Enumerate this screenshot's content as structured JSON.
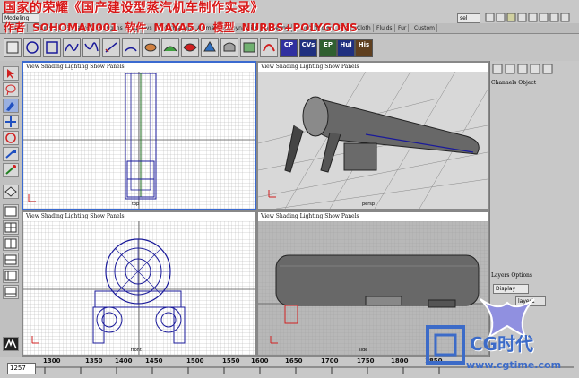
{
  "overlay": {
    "title": "国家的荣耀《国产建设型蒸汽机车制作实录》",
    "author_label": "作者",
    "author": "SOHOMAN001",
    "software_label": "软件",
    "software": "MAYA5.0",
    "model_label": "模型",
    "model": "NURBS+POLYGONS"
  },
  "status_line": {
    "mode": "Modeling",
    "sel_label": "sel"
  },
  "shelf_tabs": [
    "General",
    "Curves",
    "Surfaces",
    "Polygons",
    "Subdivs",
    "Deformation",
    "Animation",
    "Dynamics",
    "Rendering",
    "PaintEffects",
    "Toon",
    "Cloth",
    "Fluids",
    "Fur",
    "Custom"
  ],
  "shelf_buttons": {
    "cv": "CP",
    "cvs": "CVs",
    "ep": "EP",
    "hull": "Hul",
    "hist": "His"
  },
  "viewports": [
    {
      "menu": "View Shading Lighting Show Panels",
      "label": "top"
    },
    {
      "menu": "View Shading Lighting Show Panels",
      "label": "persp"
    },
    {
      "menu": "View Shading Lighting Show Panels",
      "label": "front"
    },
    {
      "menu": "View Shading Lighting Show Panels",
      "label": "side"
    }
  ],
  "channel_box": {
    "menu": "Channels Object"
  },
  "layers": {
    "menu": "Layers Options",
    "display": "Display",
    "layer_name": "layer1"
  },
  "time_slider": {
    "current_frame": "1257",
    "ticks": [
      "1300",
      "1350",
      "1400",
      "1450",
      "1500",
      "1550",
      "1600",
      "1650",
      "1700",
      "1750",
      "1800",
      "1850"
    ]
  },
  "watermark": {
    "logo": "CG时代",
    "url": "www.cgtime.com"
  },
  "colors": {
    "overlay_red": "#d81818",
    "active_viewport": "#3a6ad0",
    "wire_blue": "#1a1a9a",
    "grid": "#9a9a9a"
  },
  "icons": [
    "select-arrow-icon",
    "lasso-icon",
    "paint-select-icon",
    "move-icon",
    "rotate-icon",
    "scale-icon",
    "manipulator-icon",
    "last-tool-icon",
    "layout-icon"
  ]
}
